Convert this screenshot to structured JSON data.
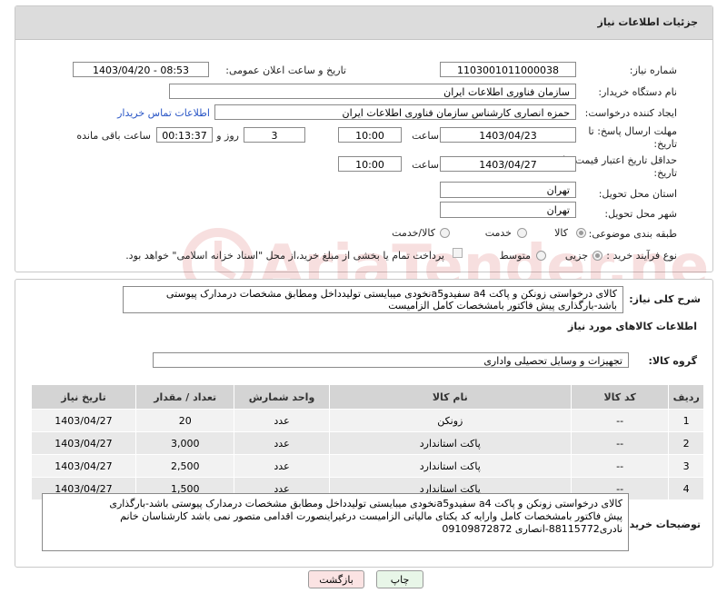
{
  "panel": {
    "title": "جزئیات اطلاعات نیاز"
  },
  "form": {
    "need_number": {
      "label": "شماره نیاز:",
      "value": "1103001011000038"
    },
    "announce_datetime": {
      "label": "تاریخ و ساعت اعلان عمومی:",
      "value": "1403/04/20 - 08:53"
    },
    "buyer_org": {
      "label": "نام دستگاه خریدار:",
      "value": "سازمان فناوری اطلاعات ایران"
    },
    "creator": {
      "label": "ایجاد کننده درخواست:",
      "value": "حمزه انصاری کارشناس سازمان فناوری اطلاعات ایران",
      "contact_link": "اطلاعات تماس خریدار"
    },
    "reply_deadline": {
      "label_line1": "مهلت ارسال پاسخ: تا",
      "label_line2": "تاریخ:",
      "date": "1403/04/23",
      "time_label": "ساعت",
      "time": "10:00",
      "days": "3",
      "days_label": "روز و",
      "remaining": "00:13:37",
      "remaining_label": "ساعت باقی مانده"
    },
    "price_validity": {
      "label_line1": "حداقل تاریخ اعتبار قیمت: تا",
      "label_line2": "تاریخ:",
      "date": "1403/04/27",
      "time_label": "ساعت",
      "time": "10:00"
    },
    "province": {
      "label": "استان محل تحویل:",
      "value": "تهران"
    },
    "city": {
      "label": "شهر محل تحویل:",
      "value": "تهران"
    },
    "category": {
      "label": "طبقه بندی موضوعی:",
      "options": [
        "کالا",
        "خدمت",
        "کالا/خدمت"
      ],
      "selected": 0
    },
    "purchase_type": {
      "label": "نوع فرآیند خرید :",
      "options": [
        "جزیی",
        "متوسط"
      ],
      "selected": 0,
      "note": "پرداخت تمام یا بخشی از مبلغ خرید،از محل \"اسناد خزانه اسلامی\" خواهد بود."
    }
  },
  "summary": {
    "label": "شرح کلی نیاز:",
    "line1": "کالای درخواستی زونکن و پاکت a4 سفیدوa5نخودی میبایستی تولیدداخل ومطابق مشخصات درمدارک پیوستی",
    "line2": "باشد-بارگذاری پیش فاکتور بامشخصات کامل الزامیست"
  },
  "goods_section": {
    "title": "اطلاعات کالاهای مورد نیاز",
    "group_label": "گروه کالا:",
    "group_value": "تجهیزات و وسایل تحصیلی واداری"
  },
  "table": {
    "headers": [
      "ردیف",
      "کد کالا",
      "نام کالا",
      "واحد شمارش",
      "تعداد / مقدار",
      "تاریخ نیاز"
    ],
    "rows": [
      [
        "1",
        "--",
        "زونکن",
        "عدد",
        "20",
        "1403/04/27"
      ],
      [
        "2",
        "--",
        "پاکت استاندارد",
        "عدد",
        "3,000",
        "1403/04/27"
      ],
      [
        "3",
        "--",
        "پاکت استاندارد",
        "عدد",
        "2,500",
        "1403/04/27"
      ],
      [
        "4",
        "--",
        "پاکت استاندارد",
        "عدد",
        "1,500",
        "1403/04/27"
      ]
    ]
  },
  "buyer_notes": {
    "label": "توضیحات خریدار:",
    "line1": "کالای درخواستی زونکن و پاکت a4 سفیدوa5نخودی میبایستی تولیدداخل ومطابق مشخصات درمدارک پیوستی باشد-بارگذاری",
    "line2": "پیش فاکتور بامشخصات کامل وارایه کد یکتای مالیاتی الزامیست درغیراینصورت اقدامی متصور نمی باشد کارشناسان خانم",
    "line3": "نادری88115772-انصاری 09109872872"
  },
  "buttons": {
    "print": "چاپ",
    "back": "بازگشت"
  },
  "watermark": {
    "text": "AriaTender.neT"
  }
}
